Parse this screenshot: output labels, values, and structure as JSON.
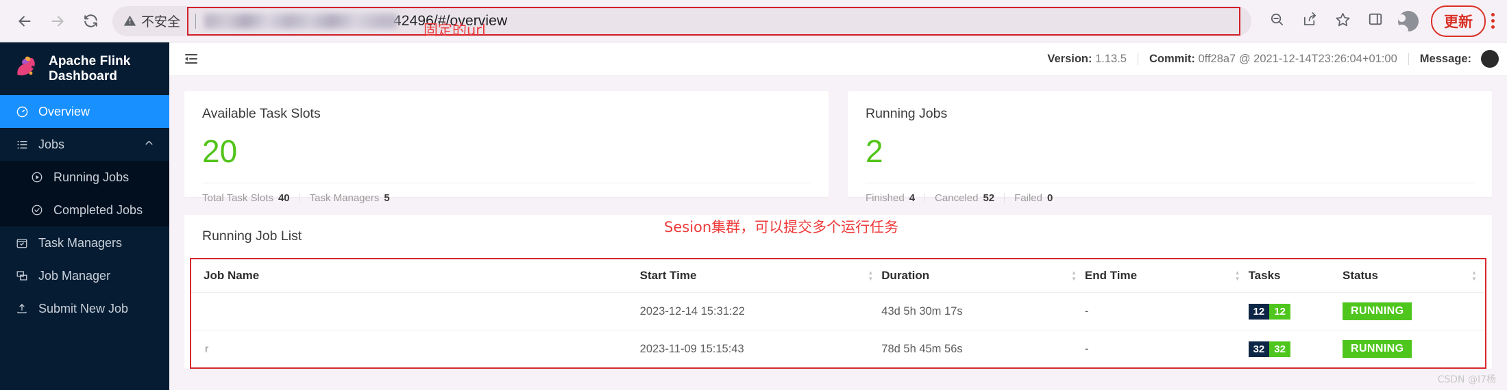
{
  "browser": {
    "back_icon": "back-arrow-icon",
    "forward_icon": "forward-arrow-icon",
    "reload_icon": "reload-icon",
    "security_label": "不安全",
    "url_visible_text": "42496/#/overview",
    "url_redacted": true,
    "annotation_url": "固定的url",
    "zoom_out_icon": "zoom-out-icon",
    "share_icon": "share-icon",
    "bookmark_icon": "star-icon",
    "sidepanel_icon": "side-panel-icon",
    "profile_icon": "profile-avatar-icon",
    "update_label": "更新",
    "menu_icon": "kebab-menu-icon"
  },
  "sidebar": {
    "brand": "Apache Flink Dashboard",
    "logo_icon": "flink-squirrel-logo",
    "items": [
      {
        "label": "Overview",
        "icon": "dashboard-icon",
        "active": true
      },
      {
        "label": "Jobs",
        "icon": "list-icon",
        "active": false,
        "expanded": true
      },
      {
        "label": "Running Jobs",
        "icon": "play-circle-icon",
        "sub": true
      },
      {
        "label": "Completed Jobs",
        "icon": "check-circle-icon",
        "sub": true
      },
      {
        "label": "Task Managers",
        "icon": "calendar-icon",
        "active": false
      },
      {
        "label": "Job Manager",
        "icon": "server-icon",
        "active": false
      },
      {
        "label": "Submit New Job",
        "icon": "upload-icon",
        "active": false
      }
    ]
  },
  "topbar": {
    "menu_fold_icon": "menu-fold-icon",
    "version_label": "Version:",
    "version_value": "1.13.5",
    "commit_label": "Commit:",
    "commit_value": "0ff28a7 @ 2021-12-14T23:26:04+01:00",
    "message_label": "Message:"
  },
  "cards": [
    {
      "title": "Available Task Slots",
      "value": "20",
      "footer": [
        {
          "label": "Total Task Slots",
          "value": "40"
        },
        {
          "label": "Task Managers",
          "value": "5"
        }
      ]
    },
    {
      "title": "Running Jobs",
      "value": "2",
      "footer": [
        {
          "label": "Finished",
          "value": "4"
        },
        {
          "label": "Canceled",
          "value": "52"
        },
        {
          "label": "Failed",
          "value": "0"
        }
      ]
    }
  ],
  "job_list": {
    "title": "Running Job List",
    "annotation": "Sesion集群，可以提交多个运行任务",
    "columns": [
      "Job Name",
      "Start Time",
      "Duration",
      "End Time",
      "Tasks",
      "Status"
    ],
    "rows": [
      {
        "job_name": "",
        "job_name_redacted": true,
        "job_name_tail": "",
        "start_time": "2023-12-14 15:31:22",
        "duration": "43d 5h 30m 17s",
        "end_time": "-",
        "tasks_total": "12",
        "tasks_running": "12",
        "status": "RUNNING"
      },
      {
        "job_name": "",
        "job_name_redacted": true,
        "job_name_tail": "r",
        "start_time": "2023-11-09 15:15:43",
        "duration": "78d 5h 45m 56s",
        "end_time": "-",
        "tasks_total": "32",
        "tasks_running": "32",
        "status": "RUNNING"
      }
    ]
  },
  "watermark": "CSDN @I7杨",
  "colors": {
    "accent_blue": "#1890ff",
    "sidebar_bg": "#061c33",
    "green": "#52c41a",
    "badge_dark": "#0d2646",
    "badge_green": "#4fc61e",
    "annotation_red": "#ee3b3b",
    "outline_red": "#d8272d"
  }
}
